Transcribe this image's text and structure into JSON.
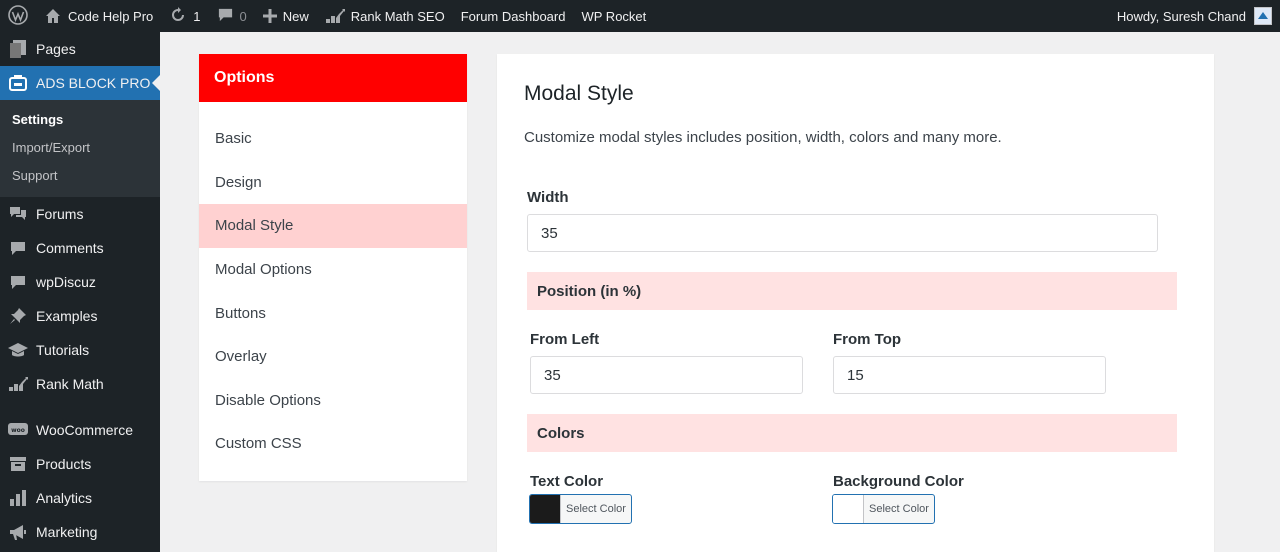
{
  "adminbar": {
    "site_name": "Code Help Pro",
    "updates_count": "1",
    "comments_count": "0",
    "new_label": "New",
    "rank_math": "Rank Math SEO",
    "forum_dashboard": "Forum Dashboard",
    "wp_rocket": "WP Rocket",
    "howdy": "Howdy, Suresh Chand"
  },
  "sidebar": {
    "pages": "Pages",
    "ads_block_pro": "ADS BLOCK PRO",
    "submenu": [
      "Settings",
      "Import/Export",
      "Support"
    ],
    "items": [
      "Forums",
      "Comments",
      "wpDiscuz",
      "Examples",
      "Tutorials",
      "Rank Math"
    ],
    "items2": [
      "WooCommerce",
      "Products",
      "Analytics",
      "Marketing"
    ]
  },
  "options": {
    "header": "Options",
    "items": [
      "Basic",
      "Design",
      "Modal Style",
      "Modal Options",
      "Buttons",
      "Overlay",
      "Disable Options",
      "Custom CSS"
    ],
    "active_index": 2
  },
  "main": {
    "title": "Modal Style",
    "description": "Customize modal styles includes position, width, colors and many more.",
    "width_label": "Width",
    "width_value": "35",
    "position_section": "Position (in %)",
    "from_left_label": "From Left",
    "from_left_value": "35",
    "from_top_label": "From Top",
    "from_top_value": "15",
    "colors_section": "Colors",
    "text_color_label": "Text Color",
    "text_color_button": "Select Color",
    "text_color_value": "#1b1b1b",
    "bg_color_label": "Background Color",
    "bg_color_button": "Select Color",
    "bg_color_value": "#ffffff"
  },
  "colors": {
    "accent": "#2271b1",
    "options_header": "#ff0000",
    "active_option": "#ffd1d1",
    "section_bg": "#ffe2e2"
  }
}
